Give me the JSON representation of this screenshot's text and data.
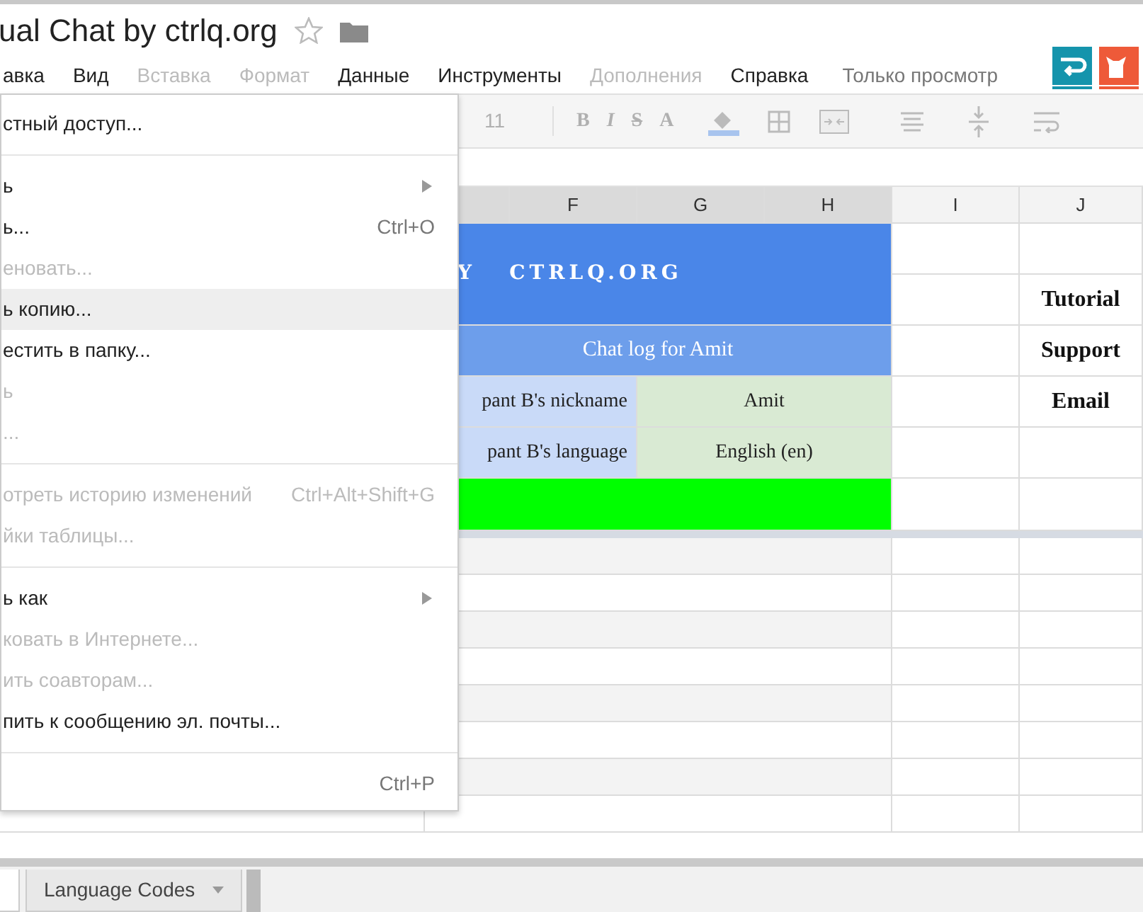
{
  "document": {
    "title": "ual Chat by ctrlq.org",
    "starred": false
  },
  "menubar": [
    {
      "label": "авка",
      "disabled": false
    },
    {
      "label": "Вид",
      "disabled": false
    },
    {
      "label": "Вставка",
      "disabled": true
    },
    {
      "label": "Формат",
      "disabled": true
    },
    {
      "label": "Данные",
      "disabled": false
    },
    {
      "label": "Инструменты",
      "disabled": false
    },
    {
      "label": "Дополнения",
      "disabled": true
    },
    {
      "label": "Справка",
      "disabled": false
    }
  ],
  "view_mode": "Только просмотр",
  "toolbar": {
    "font_size": "11",
    "text_styles": [
      "B",
      "I",
      "S",
      "A"
    ]
  },
  "file_menu": [
    {
      "kind": "item",
      "label": "стный доступ...",
      "disabled": false,
      "selected": false
    },
    {
      "kind": "separator"
    },
    {
      "kind": "item",
      "label": "ь",
      "disabled": false,
      "selected": false,
      "submenu": true
    },
    {
      "kind": "item",
      "label": "ь...",
      "shortcut": "Ctrl+O",
      "disabled": false,
      "selected": false
    },
    {
      "kind": "item",
      "label": "еновать...",
      "disabled": true,
      "selected": false
    },
    {
      "kind": "item",
      "label": "ь копию...",
      "disabled": false,
      "selected": true
    },
    {
      "kind": "item",
      "label": "естить в папку...",
      "disabled": false,
      "selected": false
    },
    {
      "kind": "item",
      "label": "ь",
      "disabled": true,
      "selected": false
    },
    {
      "kind": "item",
      "label": "...",
      "disabled": true,
      "selected": false
    },
    {
      "kind": "separator"
    },
    {
      "kind": "item",
      "label": "отреть историю изменений",
      "shortcut": "Ctrl+Alt+Shift+G",
      "disabled": true,
      "selected": false
    },
    {
      "kind": "item",
      "label": "йки таблицы...",
      "disabled": true,
      "selected": false
    },
    {
      "kind": "separator"
    },
    {
      "kind": "item",
      "label": "ь как",
      "disabled": false,
      "selected": false,
      "submenu": true
    },
    {
      "kind": "item",
      "label": "ковать в Интернете...",
      "disabled": true,
      "selected": false
    },
    {
      "kind": "item",
      "label": "ить соавторам...",
      "disabled": true,
      "selected": false
    },
    {
      "kind": "item",
      "label": "пить к сообщению эл. почты...",
      "disabled": false,
      "selected": false
    },
    {
      "kind": "separator"
    },
    {
      "kind": "item",
      "shortcut": "Ctrl+P",
      "disabled": false,
      "selected": false
    }
  ],
  "columns": [
    {
      "label": "F",
      "selected": true
    },
    {
      "label": "G",
      "selected": true
    },
    {
      "label": "H",
      "selected": true
    },
    {
      "label": "I",
      "selected": false
    },
    {
      "label": "J",
      "selected": false
    }
  ],
  "sheet": {
    "banner": "Y   CTRLQ.ORG",
    "subtitle": "Chat log for Amit",
    "fields": [
      {
        "label": "pant B's nickname",
        "value": "Amit"
      },
      {
        "label": "pant B's language",
        "value": "English (en)"
      }
    ],
    "links": [
      "Tutorial",
      "Support",
      "Email"
    ]
  },
  "sheet_tabs": [
    {
      "selected": true
    },
    {
      "label": "Language Codes",
      "selected": false
    }
  ]
}
